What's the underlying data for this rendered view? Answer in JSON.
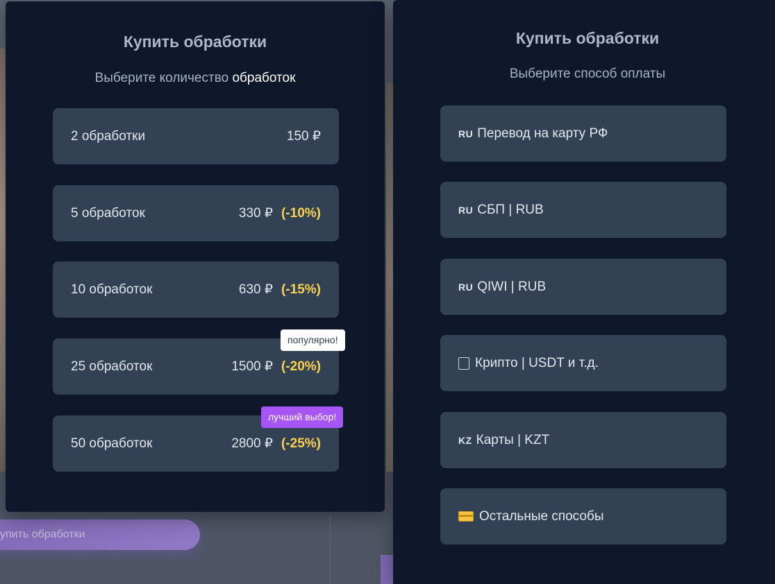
{
  "background": {
    "cta_label": "упить обработки"
  },
  "quantity_modal": {
    "title": "Купить обработки",
    "subtitle_prefix": "Выберите количество",
    "subtitle_accent": "обработок",
    "options": [
      {
        "label": "2 обработки",
        "price": "150 ₽",
        "discount": ""
      },
      {
        "label": "5 обработок",
        "price": "330 ₽",
        "discount": "(-10%)"
      },
      {
        "label": "10 обработок",
        "price": "630 ₽",
        "discount": "(-15%)"
      },
      {
        "label": "25 обработок",
        "price": "1500 ₽",
        "discount": "(-20%)",
        "badge": "популярно!"
      },
      {
        "label": "50 обработок",
        "price": "2800 ₽",
        "discount": "(-25%)",
        "badge": "лучший выбор!"
      }
    ]
  },
  "payment_modal": {
    "title": "Купить обработки",
    "subtitle": "Выберите способ оплаты",
    "methods": [
      {
        "icon": "ru-flag-icon",
        "flag": "RU",
        "label": "Перевод на карту РФ"
      },
      {
        "icon": "ru-flag-icon",
        "flag": "RU",
        "label": "СБП | RUB"
      },
      {
        "icon": "ru-flag-icon",
        "flag": "RU",
        "label": "QIWI | RUB"
      },
      {
        "icon": "missing-glyph-icon",
        "flag": "",
        "label": "Крипто | USDT и т.д."
      },
      {
        "icon": "kz-flag-icon",
        "flag": "KZ",
        "label": "Карты | KZT"
      },
      {
        "icon": "credit-card-icon",
        "flag": "",
        "label": "Остальные способы"
      }
    ]
  },
  "colors": {
    "modal_bg": "#0f172a",
    "option_bg": "#334155",
    "discount": "#fcd34d",
    "badge_popular_bg": "#ffffff",
    "badge_best_bg": "#a855f7"
  }
}
